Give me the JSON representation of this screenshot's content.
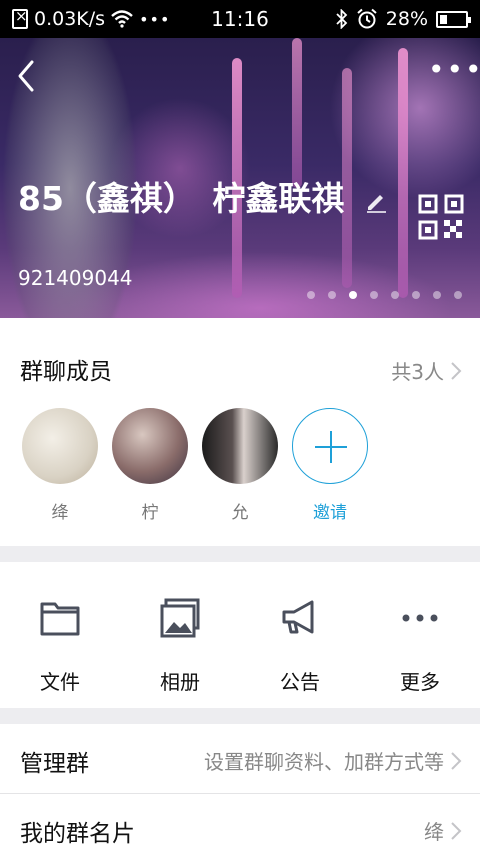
{
  "status_bar": {
    "network_speed": "0.03K/s",
    "time": "11:16",
    "battery_percent": "28%",
    "battery_level": 0.28
  },
  "header": {
    "group_title": "85（鑫祺）　柠鑫联祺",
    "group_number": "921409044",
    "banner_page_count": 8,
    "banner_active_index": 2
  },
  "members": {
    "section_title": "群聊成员",
    "count_label": "共3人",
    "list": [
      {
        "name": "绛",
        "avatar": "teacup-avatar"
      },
      {
        "name": "柠",
        "avatar": "girl-avatar"
      },
      {
        "name": "允",
        "avatar": "couple-avatar"
      }
    ],
    "invite_label": "邀请"
  },
  "actions": [
    {
      "label": "文件",
      "icon": "folder-icon"
    },
    {
      "label": "相册",
      "icon": "album-icon"
    },
    {
      "label": "公告",
      "icon": "megaphone-icon"
    },
    {
      "label": "更多",
      "icon": "more-icon"
    }
  ],
  "manage": {
    "title": "管理群",
    "hint": "设置群聊资料、加群方式等"
  },
  "my_card": {
    "title": "我的群名片",
    "value": "绛"
  },
  "colors": {
    "accent": "#1ea0d8",
    "background": "#ededf0"
  }
}
